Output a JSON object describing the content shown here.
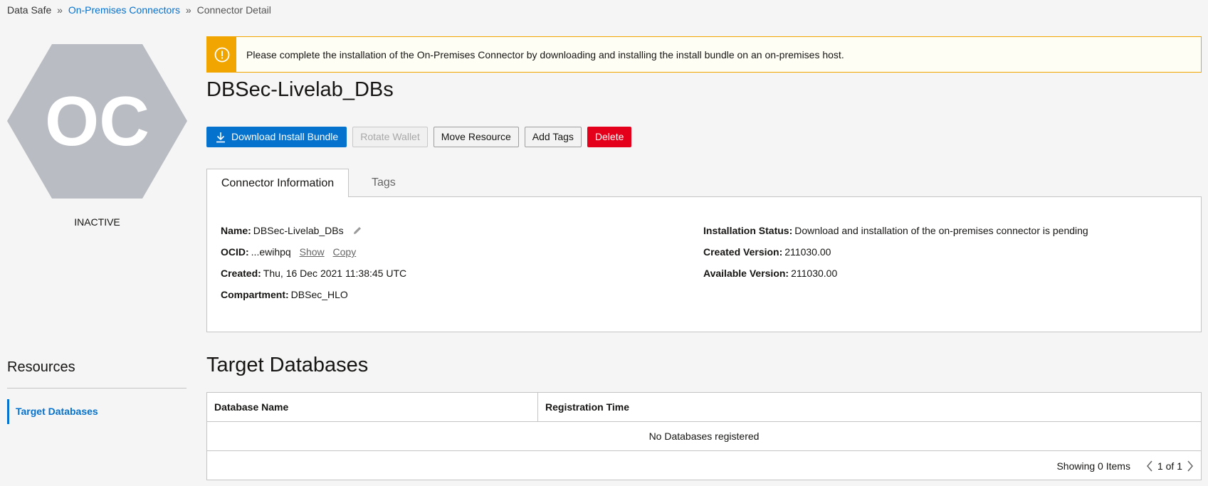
{
  "breadcrumb": {
    "root": "Data Safe",
    "separator": "»",
    "parent": "On-Premises Connectors",
    "current": "Connector Detail"
  },
  "badge": {
    "initials": "OC",
    "status": "INACTIVE",
    "hex_color": "#b9bcc2"
  },
  "alert": {
    "icon": "warning-icon",
    "text": "Please complete the installation of the On-Premises Connector by downloading and installing the install bundle on an on-premises host."
  },
  "page_title": "DBSec-Livelab_DBs",
  "actions": {
    "download": "Download Install Bundle",
    "rotate": "Rotate Wallet",
    "move": "Move Resource",
    "add_tags": "Add Tags",
    "delete": "Delete"
  },
  "tabs": {
    "info": "Connector Information",
    "tags": "Tags"
  },
  "info": {
    "name_label": "Name:",
    "name_value": "DBSec-Livelab_DBs",
    "ocid_label": "OCID:",
    "ocid_value": "...ewihpq",
    "ocid_show": "Show",
    "ocid_copy": "Copy",
    "created_label": "Created:",
    "created_value": "Thu, 16 Dec 2021 11:38:45 UTC",
    "compartment_label": "Compartment:",
    "compartment_value": "DBSec_HLO",
    "install_status_label": "Installation Status:",
    "install_status_value": "Download and installation of the on-premises connector is pending",
    "created_version_label": "Created Version:",
    "created_version_value": "211030.00",
    "available_version_label": "Available Version:",
    "available_version_value": "211030.00"
  },
  "resources": {
    "title": "Resources",
    "items": [
      "Target Databases"
    ]
  },
  "target_databases": {
    "title": "Target Databases",
    "columns": [
      "Database Name",
      "Registration Time"
    ],
    "empty_text": "No Databases registered",
    "showing": "Showing 0 Items",
    "page_text": "1 of 1"
  },
  "colors": {
    "brand_blue": "#0572ce",
    "danger_red": "#e4001b",
    "warning": "#f0a500"
  }
}
